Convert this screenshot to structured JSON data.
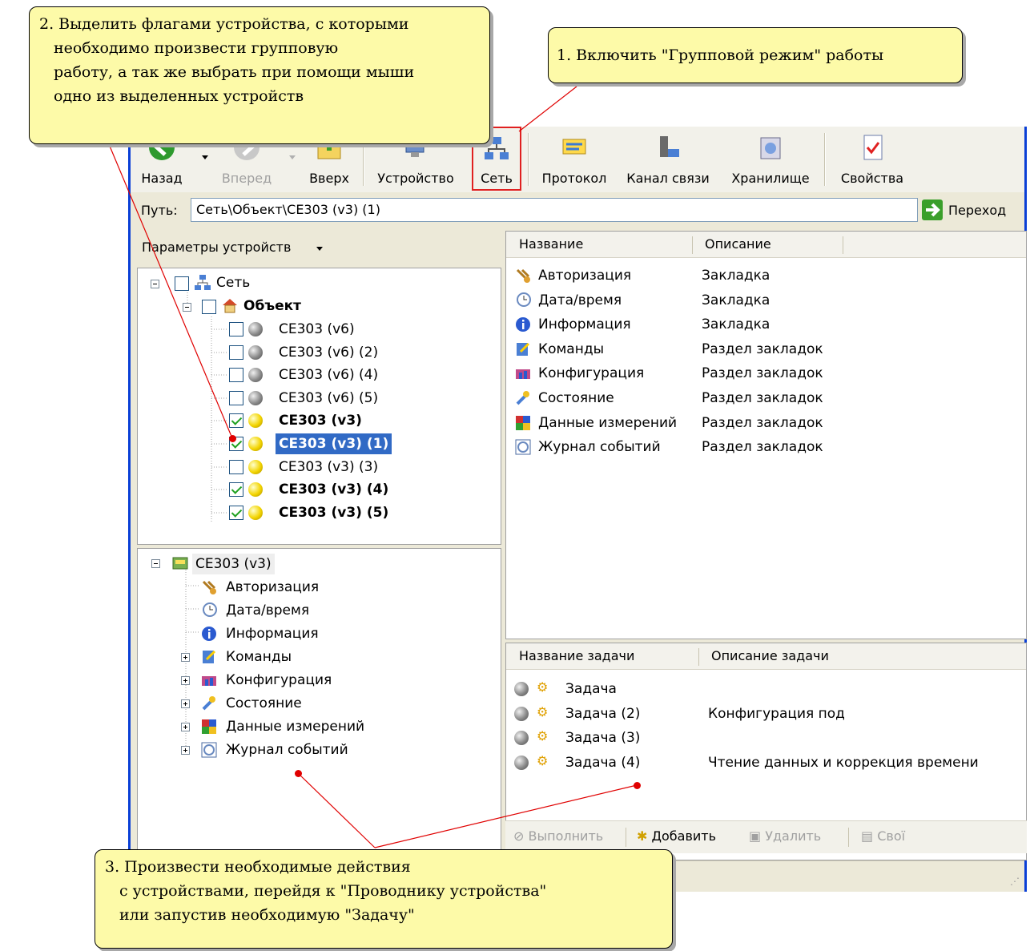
{
  "callouts": {
    "one": "1. Включить \"Групповой режим\" работы",
    "two_lines": [
      "2. Выделить флагами устройства, с которыми",
      "необходимо произвести  групповую",
      "работу, а так же выбрать при помощи мыши",
      "одно из выделенных устройств"
    ],
    "three_lines": [
      "3. Произвести необходимые действия",
      "с устройствами, перейдя к \"Проводнику устройства\"",
      "или запустив необходимую \"Задачу\""
    ]
  },
  "toolbar": {
    "back": "Назад",
    "forward": "Вперед",
    "up": "Вверх",
    "device": "Устройство",
    "network": "Сеть",
    "protocol": "Протокол",
    "channel": "Канал связи",
    "storage": "Хранилище",
    "properties": "Свойства"
  },
  "address": {
    "label": "Путь:",
    "value": "Сеть\\Объект\\CE303 (v3) (1)",
    "go": "Переход"
  },
  "left_panel": {
    "header": "Параметры устройств",
    "tree": {
      "network": "Сеть",
      "object": "Объект",
      "devices": [
        {
          "label": "CE303 (v6)",
          "checked": false,
          "status": "grey",
          "bold": false,
          "selected": false
        },
        {
          "label": "CE303 (v6) (2)",
          "checked": false,
          "status": "grey",
          "bold": false,
          "selected": false
        },
        {
          "label": "CE303 (v6) (4)",
          "checked": false,
          "status": "grey",
          "bold": false,
          "selected": false
        },
        {
          "label": "CE303 (v6) (5)",
          "checked": false,
          "status": "grey",
          "bold": false,
          "selected": false
        },
        {
          "label": "CE303 (v3)",
          "checked": true,
          "status": "yellow",
          "bold": true,
          "selected": false
        },
        {
          "label": "CE303 (v3) (1)",
          "checked": true,
          "status": "yellow",
          "bold": true,
          "selected": true
        },
        {
          "label": "CE303 (v3) (3)",
          "checked": false,
          "status": "yellow",
          "bold": false,
          "selected": false
        },
        {
          "label": "CE303 (v3) (4)",
          "checked": true,
          "status": "yellow",
          "bold": true,
          "selected": false
        },
        {
          "label": "CE303 (v3) (5)",
          "checked": true,
          "status": "yellow",
          "bold": true,
          "selected": false
        }
      ]
    }
  },
  "device_tree": {
    "root": "CE303 (v3)",
    "items": [
      {
        "label": "Авторизация",
        "expandable": false,
        "icon": "keys-icon"
      },
      {
        "label": "Дата/время",
        "expandable": false,
        "icon": "clock-icon"
      },
      {
        "label": "Информация",
        "expandable": false,
        "icon": "info-icon"
      },
      {
        "label": "Команды",
        "expandable": true,
        "icon": "commands-icon"
      },
      {
        "label": "Конфигурация",
        "expandable": true,
        "icon": "config-icon"
      },
      {
        "label": "Состояние",
        "expandable": true,
        "icon": "state-icon"
      },
      {
        "label": "Данные измерений",
        "expandable": true,
        "icon": "measurements-icon"
      },
      {
        "label": "Журнал событий",
        "expandable": true,
        "icon": "event-log-icon"
      }
    ]
  },
  "tabs_list": {
    "col_name": "Название",
    "col_desc": "Описание",
    "rows": [
      {
        "name": "Авторизация",
        "desc": "Закладка",
        "icon": "keys-icon"
      },
      {
        "name": "Дата/время",
        "desc": "Закладка",
        "icon": "clock-icon"
      },
      {
        "name": "Информация",
        "desc": "Закладка",
        "icon": "info-icon"
      },
      {
        "name": "Команды",
        "desc": "Раздел закладок",
        "icon": "commands-icon"
      },
      {
        "name": "Конфигурация",
        "desc": "Раздел закладок",
        "icon": "config-icon"
      },
      {
        "name": "Состояние",
        "desc": "Раздел закладок",
        "icon": "state-icon"
      },
      {
        "name": "Данные измерений",
        "desc": "Раздел закладок",
        "icon": "measurements-icon"
      },
      {
        "name": "Журнал событий",
        "desc": "Раздел закладок",
        "icon": "event-log-icon"
      }
    ]
  },
  "tasks": {
    "col_name": "Название задачи",
    "col_desc": "Описание задачи",
    "rows": [
      {
        "name": "Задача",
        "desc": ""
      },
      {
        "name": "Задача (2)",
        "desc": "Конфигурация под"
      },
      {
        "name": "Задача (3)",
        "desc": ""
      },
      {
        "name": "Задача (4)",
        "desc": "Чтение данных и коррекция времени"
      }
    ],
    "buttons": {
      "run": "Выполнить",
      "add": "Добавить",
      "delete": "Удалить",
      "props": "Свої"
    }
  },
  "colors": {
    "callout_bg": "#fdfaa8",
    "selection": "#316ac5",
    "arrow_line": "#e00000",
    "window_border": "#0a3fd6"
  }
}
